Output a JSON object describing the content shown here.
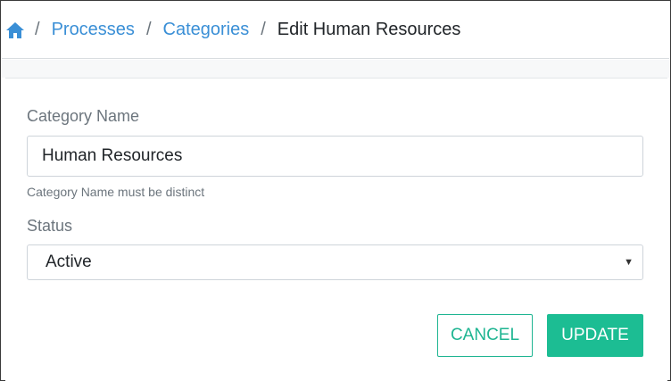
{
  "breadcrumb": {
    "home_icon": "home-icon",
    "separator": "/",
    "items": [
      {
        "label": "Processes"
      },
      {
        "label": "Categories"
      }
    ],
    "current": "Edit Human Resources"
  },
  "form": {
    "category_name": {
      "label": "Category Name",
      "value": "Human Resources",
      "help": "Category Name must be distinct"
    },
    "status": {
      "label": "Status",
      "value": "Active",
      "arrow_icon": "caret-down-icon"
    }
  },
  "actions": {
    "cancel_label": "CANCEL",
    "update_label": "UPDATE"
  },
  "colors": {
    "link": "#3a8fd6",
    "accent": "#1cbd93"
  }
}
